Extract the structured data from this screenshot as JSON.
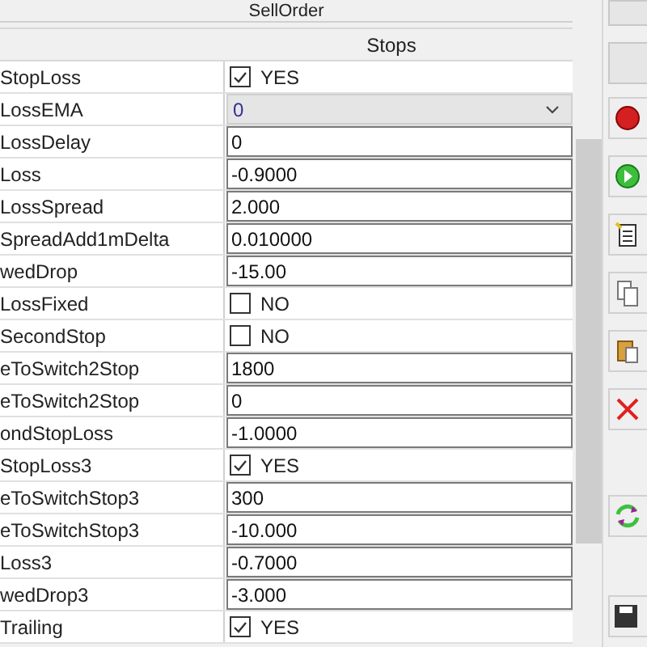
{
  "top_bar": {
    "title": "SellOrder"
  },
  "section": {
    "title": "Stops"
  },
  "rows": [
    {
      "name": "StopLoss",
      "kind": "checkbox",
      "checked": true,
      "value": "YES"
    },
    {
      "name": "LossEMA",
      "kind": "dropdown",
      "value": "0"
    },
    {
      "name": "LossDelay",
      "kind": "text",
      "value": "0"
    },
    {
      "name": "Loss",
      "kind": "text",
      "value": "-0.9000"
    },
    {
      "name": "LossSpread",
      "kind": "text",
      "value": "2.000"
    },
    {
      "name": "SpreadAdd1mDelta",
      "kind": "text",
      "value": "0.010000"
    },
    {
      "name": "wedDrop",
      "kind": "text",
      "value": "-15.00"
    },
    {
      "name": "LossFixed",
      "kind": "checkbox",
      "checked": false,
      "value": "NO"
    },
    {
      "name": "SecondStop",
      "kind": "checkbox",
      "checked": false,
      "value": "NO"
    },
    {
      "name": "eToSwitch2Stop",
      "kind": "text",
      "value": "1800"
    },
    {
      "name": "eToSwitch2Stop",
      "kind": "text",
      "value": "0"
    },
    {
      "name": "ondStopLoss",
      "kind": "text",
      "value": "-1.0000"
    },
    {
      "name": "StopLoss3",
      "kind": "checkbox",
      "checked": true,
      "value": "YES"
    },
    {
      "name": "eToSwitchStop3",
      "kind": "text",
      "value": "300"
    },
    {
      "name": "eToSwitchStop3",
      "kind": "text",
      "value": "-10.000"
    },
    {
      "name": "Loss3",
      "kind": "text",
      "value": "-0.7000"
    },
    {
      "name": "wedDrop3",
      "kind": "text",
      "value": "-3.000"
    },
    {
      "name": "Trailing",
      "kind": "checkbox",
      "checked": true,
      "value": "YES"
    }
  ]
}
